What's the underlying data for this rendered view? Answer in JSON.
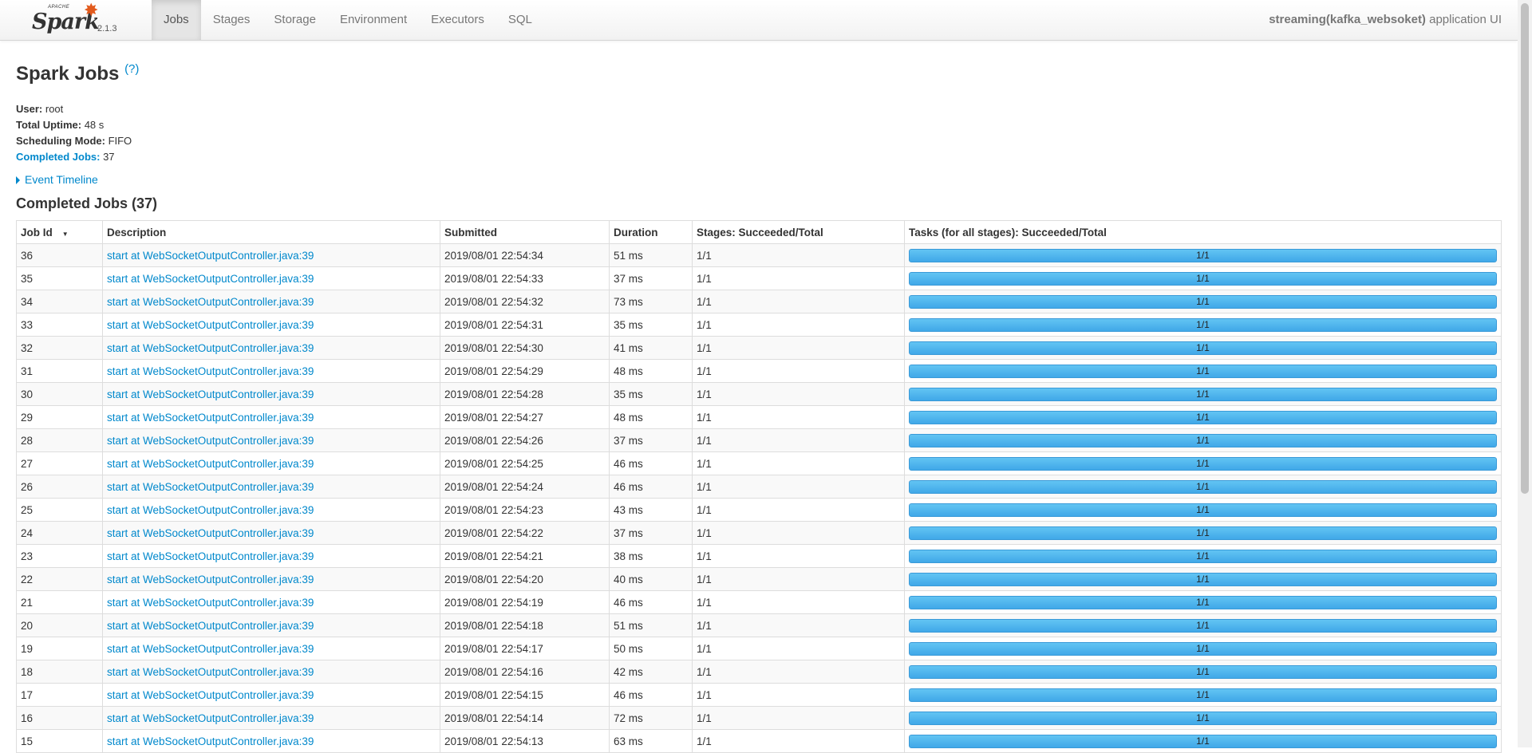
{
  "brand": {
    "apache": "APACHE",
    "name": "Spark",
    "version": "2.1.3"
  },
  "nav": {
    "tabs": [
      {
        "label": "Jobs",
        "active": true
      },
      {
        "label": "Stages"
      },
      {
        "label": "Storage"
      },
      {
        "label": "Environment"
      },
      {
        "label": "Executors"
      },
      {
        "label": "SQL"
      }
    ],
    "app_name": "streaming(kafka_websoket)",
    "app_suffix": " application UI"
  },
  "page": {
    "title": "Spark Jobs",
    "help": "(?)",
    "summary": {
      "user_label": "User:",
      "user": " root",
      "uptime_label": "Total Uptime:",
      "uptime": " 48 s",
      "mode_label": "Scheduling Mode:",
      "mode": " FIFO",
      "completed_label": "Completed Jobs:",
      "completed": " 37"
    },
    "event_timeline": "Event Timeline",
    "section_title": "Completed Jobs (37)"
  },
  "table": {
    "headers": [
      "Job Id",
      "Description",
      "Submitted",
      "Duration",
      "Stages: Succeeded/Total",
      "Tasks (for all stages): Succeeded/Total"
    ],
    "sort_indicator": "▼",
    "rows": [
      {
        "id": "36",
        "desc": "start at WebSocketOutputController.java:39",
        "submitted": "2019/08/01 22:54:34",
        "duration": "51 ms",
        "stages": "1/1",
        "tasks": "1/1",
        "progress": 1.0
      },
      {
        "id": "35",
        "desc": "start at WebSocketOutputController.java:39",
        "submitted": "2019/08/01 22:54:33",
        "duration": "37 ms",
        "stages": "1/1",
        "tasks": "1/1",
        "progress": 1.0
      },
      {
        "id": "34",
        "desc": "start at WebSocketOutputController.java:39",
        "submitted": "2019/08/01 22:54:32",
        "duration": "73 ms",
        "stages": "1/1",
        "tasks": "1/1",
        "progress": 1.0
      },
      {
        "id": "33",
        "desc": "start at WebSocketOutputController.java:39",
        "submitted": "2019/08/01 22:54:31",
        "duration": "35 ms",
        "stages": "1/1",
        "tasks": "1/1",
        "progress": 1.0
      },
      {
        "id": "32",
        "desc": "start at WebSocketOutputController.java:39",
        "submitted": "2019/08/01 22:54:30",
        "duration": "41 ms",
        "stages": "1/1",
        "tasks": "1/1",
        "progress": 1.0
      },
      {
        "id": "31",
        "desc": "start at WebSocketOutputController.java:39",
        "submitted": "2019/08/01 22:54:29",
        "duration": "48 ms",
        "stages": "1/1",
        "tasks": "1/1",
        "progress": 1.0
      },
      {
        "id": "30",
        "desc": "start at WebSocketOutputController.java:39",
        "submitted": "2019/08/01 22:54:28",
        "duration": "35 ms",
        "stages": "1/1",
        "tasks": "1/1",
        "progress": 1.0
      },
      {
        "id": "29",
        "desc": "start at WebSocketOutputController.java:39",
        "submitted": "2019/08/01 22:54:27",
        "duration": "48 ms",
        "stages": "1/1",
        "tasks": "1/1",
        "progress": 1.0
      },
      {
        "id": "28",
        "desc": "start at WebSocketOutputController.java:39",
        "submitted": "2019/08/01 22:54:26",
        "duration": "37 ms",
        "stages": "1/1",
        "tasks": "1/1",
        "progress": 1.0
      },
      {
        "id": "27",
        "desc": "start at WebSocketOutputController.java:39",
        "submitted": "2019/08/01 22:54:25",
        "duration": "46 ms",
        "stages": "1/1",
        "tasks": "1/1",
        "progress": 1.0
      },
      {
        "id": "26",
        "desc": "start at WebSocketOutputController.java:39",
        "submitted": "2019/08/01 22:54:24",
        "duration": "46 ms",
        "stages": "1/1",
        "tasks": "1/1",
        "progress": 1.0
      },
      {
        "id": "25",
        "desc": "start at WebSocketOutputController.java:39",
        "submitted": "2019/08/01 22:54:23",
        "duration": "43 ms",
        "stages": "1/1",
        "tasks": "1/1",
        "progress": 1.0
      },
      {
        "id": "24",
        "desc": "start at WebSocketOutputController.java:39",
        "submitted": "2019/08/01 22:54:22",
        "duration": "37 ms",
        "stages": "1/1",
        "tasks": "1/1",
        "progress": 1.0
      },
      {
        "id": "23",
        "desc": "start at WebSocketOutputController.java:39",
        "submitted": "2019/08/01 22:54:21",
        "duration": "38 ms",
        "stages": "1/1",
        "tasks": "1/1",
        "progress": 1.0
      },
      {
        "id": "22",
        "desc": "start at WebSocketOutputController.java:39",
        "submitted": "2019/08/01 22:54:20",
        "duration": "40 ms",
        "stages": "1/1",
        "tasks": "1/1",
        "progress": 1.0
      },
      {
        "id": "21",
        "desc": "start at WebSocketOutputController.java:39",
        "submitted": "2019/08/01 22:54:19",
        "duration": "46 ms",
        "stages": "1/1",
        "tasks": "1/1",
        "progress": 1.0
      },
      {
        "id": "20",
        "desc": "start at WebSocketOutputController.java:39",
        "submitted": "2019/08/01 22:54:18",
        "duration": "51 ms",
        "stages": "1/1",
        "tasks": "1/1",
        "progress": 1.0
      },
      {
        "id": "19",
        "desc": "start at WebSocketOutputController.java:39",
        "submitted": "2019/08/01 22:54:17",
        "duration": "50 ms",
        "stages": "1/1",
        "tasks": "1/1",
        "progress": 1.0
      },
      {
        "id": "18",
        "desc": "start at WebSocketOutputController.java:39",
        "submitted": "2019/08/01 22:54:16",
        "duration": "42 ms",
        "stages": "1/1",
        "tasks": "1/1",
        "progress": 1.0
      },
      {
        "id": "17",
        "desc": "start at WebSocketOutputController.java:39",
        "submitted": "2019/08/01 22:54:15",
        "duration": "46 ms",
        "stages": "1/1",
        "tasks": "1/1",
        "progress": 1.0
      },
      {
        "id": "16",
        "desc": "start at WebSocketOutputController.java:39",
        "submitted": "2019/08/01 22:54:14",
        "duration": "72 ms",
        "stages": "1/1",
        "tasks": "1/1",
        "progress": 1.0
      },
      {
        "id": "15",
        "desc": "start at WebSocketOutputController.java:39",
        "submitted": "2019/08/01 22:54:13",
        "duration": "63 ms",
        "stages": "1/1",
        "tasks": "1/1",
        "progress": 1.0
      }
    ]
  },
  "colors": {
    "link": "#0088cc",
    "progress_bar": "#4fb7ef",
    "spark_orange": "#e25a1c"
  }
}
